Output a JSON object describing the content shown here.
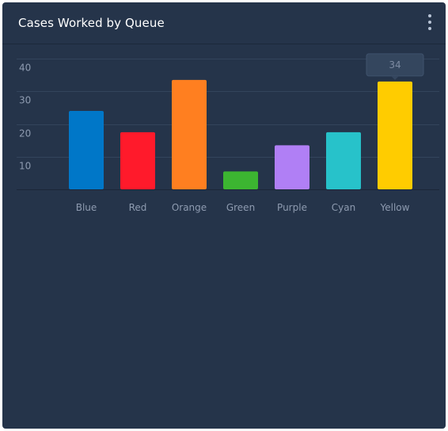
{
  "card": {
    "title": "Cases Worked by Queue",
    "menu_icon": "more-vertical-icon"
  },
  "colors": {
    "card_background": "#25344a",
    "grid": "#33445c",
    "axis_text": "#8e9bb0",
    "tooltip_background": "#34465e",
    "tooltip_text": "#7d8ba2"
  },
  "tooltip": {
    "value": "34"
  },
  "chart_data": {
    "type": "bar",
    "title": "",
    "xlabel": "",
    "ylabel": "",
    "ylim": [
      0,
      40
    ],
    "yticks": [
      10,
      20,
      30,
      40
    ],
    "grid": true,
    "categories": [
      "Blue",
      "Red",
      "Orange",
      "Green",
      "Purple",
      "Cyan",
      "Yellow"
    ],
    "values": [
      24,
      17.5,
      33.5,
      5.5,
      13.5,
      17.5,
      33
    ],
    "bar_colors": [
      "#0077c8",
      "#ff1a2b",
      "#ff7f20",
      "#3cb531",
      "#b07ff5",
      "#27c2ca",
      "#ffcc00"
    ]
  }
}
